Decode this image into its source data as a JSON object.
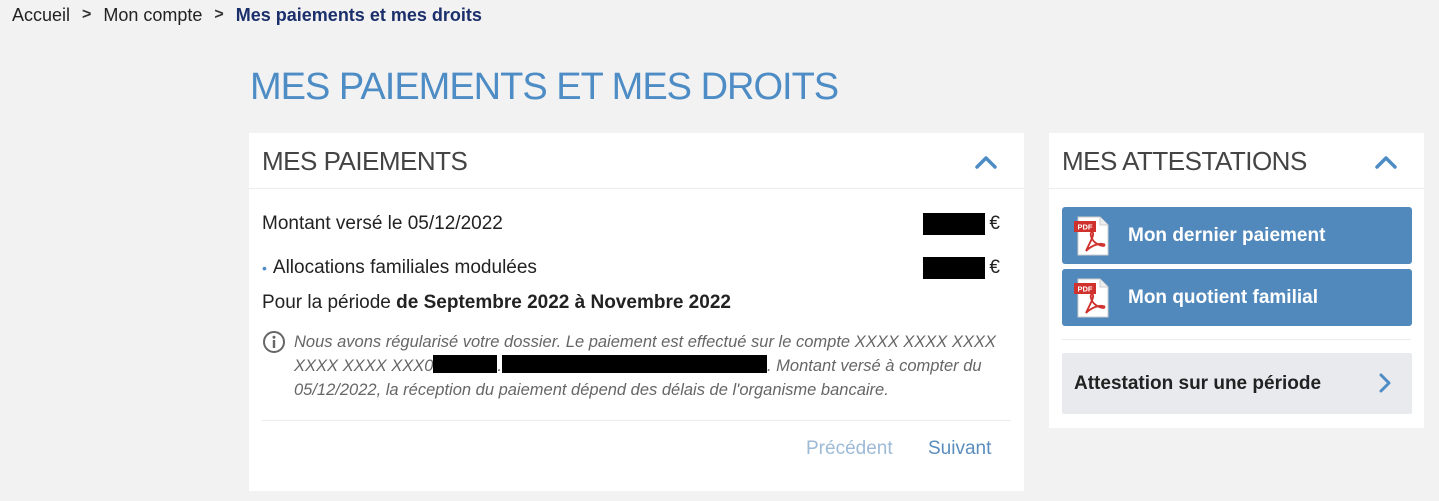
{
  "breadcrumb": {
    "home": "Accueil",
    "account": "Mon compte",
    "current": "Mes paiements et mes droits",
    "separator": ">"
  },
  "page": {
    "title": "MES PAIEMENTS ET MES DROITS"
  },
  "payments": {
    "title": "MES PAIEMENTS",
    "amount_label": "Montant versé le 05/12/2022",
    "allowance_label": "Allocations familiales modulées",
    "currency": "€",
    "bullet": "•",
    "period_prefix": "Pour la période ",
    "period_value": "de Septembre 2022 à Novembre 2022",
    "info_part1": "Nous avons régularisé votre dossier. Le paiement est effectué sur le compte XXXX XXXX XXXX XXXX XXXX XXX0",
    "info_sep": ".",
    "info_part2": ". Montant versé à compter du 05/12/2022, la réception du paiement dépend des délais de l'organisme bancaire.",
    "previous": "Précédent",
    "next": "Suivant"
  },
  "attestations": {
    "title": "MES ATTESTATIONS",
    "last_payment": "Mon dernier paiement",
    "family_quotient": "Mon quotient familial",
    "period": "Attestation sur une période",
    "pdf_badge": "PDF"
  },
  "colors": {
    "accent": "#4d8cc5",
    "button": "#5289bd",
    "breadcrumb_current": "#1b2f6b",
    "pager": "#5a8dbd",
    "pager_disabled": "#9dbad6"
  }
}
